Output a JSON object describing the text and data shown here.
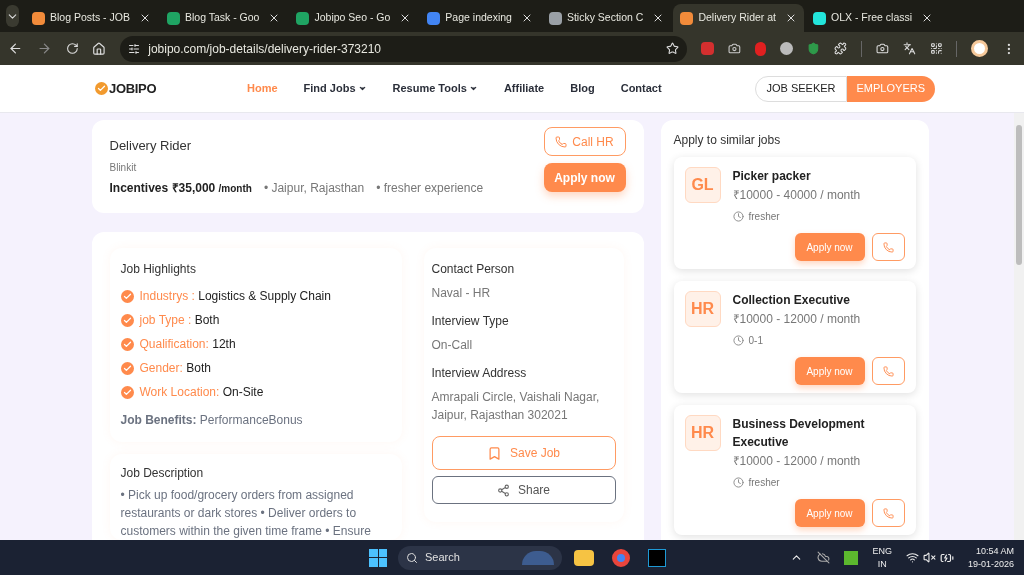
{
  "browser": {
    "tabs": [
      {
        "title": "Blog Posts - JOB",
        "selected": false,
        "color": "#f28b3a"
      },
      {
        "title": "Blog Task - Goo",
        "selected": false,
        "color": "#1fa463"
      },
      {
        "title": "Jobipo Seo - Go",
        "selected": false,
        "color": "#1fa463"
      },
      {
        "title": "Page indexing",
        "selected": false,
        "color": "#4285f4"
      },
      {
        "title": "Sticky Section C",
        "selected": false,
        "color": "#9aa0a6"
      },
      {
        "title": "Delivery Rider at",
        "selected": true,
        "color": "#f28b3a"
      },
      {
        "title": "OLX - Free classi",
        "selected": false,
        "color": "#23e5db"
      }
    ],
    "url": "jobipo.com/job-details/delivery-rider-373210"
  },
  "header": {
    "logo": "JOBIPO",
    "nav": [
      {
        "label": "Home",
        "selected": true,
        "dropdown": false
      },
      {
        "label": "Find Jobs",
        "selected": false,
        "dropdown": true
      },
      {
        "label": "Resume Tools",
        "selected": false,
        "dropdown": true
      },
      {
        "label": "Affiliate",
        "selected": false,
        "dropdown": false
      },
      {
        "label": "Blog",
        "selected": false,
        "dropdown": false
      },
      {
        "label": "Contact",
        "selected": false,
        "dropdown": false
      }
    ],
    "job_seeker": "JOB SEEKER",
    "employers": "EMPLOYERS"
  },
  "job": {
    "title": "Delivery Rider",
    "company": "Blinkit",
    "salary": "Incentives ₹35,000",
    "salary_unit": "/month",
    "location": "• Jaipur, Rajasthan",
    "experience": "• fresher experience",
    "call_hr": "Call HR",
    "apply": "Apply now"
  },
  "highlights": {
    "title": "Job Highlights",
    "items": [
      {
        "label": "Industrys :",
        "value": "Logistics & Supply Chain"
      },
      {
        "label": "job Type :",
        "value": "Both"
      },
      {
        "label": "Qualification:",
        "value": "12th"
      },
      {
        "label": "Gender:",
        "value": "Both"
      },
      {
        "label": "Work Location:",
        "value": "On-Site"
      }
    ],
    "benefits_label": "Job Benefits:",
    "benefits_value": "PerformanceBonus"
  },
  "description": {
    "title": "Job Description",
    "text": "• Pick up food/grocery orders from assigned restaurants or dark stores • Deliver orders to customers within the given time frame • Ensure"
  },
  "contact": {
    "fields": [
      {
        "label": "Contact Person",
        "value": "Naval - HR"
      },
      {
        "label": "Interview Type",
        "value": "On-Call"
      },
      {
        "label": "Interview Address",
        "value": "Amrapali Circle, Vaishali Nagar, Jaipur, Rajasthan 302021"
      }
    ],
    "save": "Save Job",
    "share": "Share"
  },
  "similar": {
    "title": "Apply to similar jobs",
    "jobs": [
      {
        "initials": "GL",
        "title": "Picker packer",
        "salary": "₹10000 - 40000 / month",
        "experience": "fresher",
        "apply": "Apply now"
      },
      {
        "initials": "HR",
        "title": "Collection Executive",
        "salary": "₹10000 - 12000 / month",
        "experience": "0-1",
        "apply": "Apply now"
      },
      {
        "initials": "HR",
        "title": "Business Development Executive",
        "salary": "₹10000 - 12000 / month",
        "experience": "fresher",
        "apply": "Apply now"
      }
    ]
  },
  "taskbar": {
    "search": "Search",
    "lang": "ENG",
    "region": "IN",
    "time": "10:54 AM",
    "date": "19-01-2026"
  }
}
